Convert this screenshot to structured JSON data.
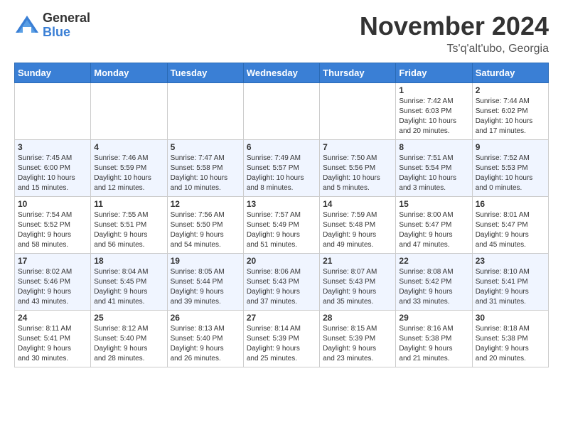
{
  "logo": {
    "general": "General",
    "blue": "Blue"
  },
  "header": {
    "month": "November 2024",
    "location": "Ts'q'alt'ubo, Georgia"
  },
  "weekdays": [
    "Sunday",
    "Monday",
    "Tuesday",
    "Wednesday",
    "Thursday",
    "Friday",
    "Saturday"
  ],
  "weeks": [
    [
      {
        "day": "",
        "info": ""
      },
      {
        "day": "",
        "info": ""
      },
      {
        "day": "",
        "info": ""
      },
      {
        "day": "",
        "info": ""
      },
      {
        "day": "",
        "info": ""
      },
      {
        "day": "1",
        "info": "Sunrise: 7:42 AM\nSunset: 6:03 PM\nDaylight: 10 hours\nand 20 minutes."
      },
      {
        "day": "2",
        "info": "Sunrise: 7:44 AM\nSunset: 6:02 PM\nDaylight: 10 hours\nand 17 minutes."
      }
    ],
    [
      {
        "day": "3",
        "info": "Sunrise: 7:45 AM\nSunset: 6:00 PM\nDaylight: 10 hours\nand 15 minutes."
      },
      {
        "day": "4",
        "info": "Sunrise: 7:46 AM\nSunset: 5:59 PM\nDaylight: 10 hours\nand 12 minutes."
      },
      {
        "day": "5",
        "info": "Sunrise: 7:47 AM\nSunset: 5:58 PM\nDaylight: 10 hours\nand 10 minutes."
      },
      {
        "day": "6",
        "info": "Sunrise: 7:49 AM\nSunset: 5:57 PM\nDaylight: 10 hours\nand 8 minutes."
      },
      {
        "day": "7",
        "info": "Sunrise: 7:50 AM\nSunset: 5:56 PM\nDaylight: 10 hours\nand 5 minutes."
      },
      {
        "day": "8",
        "info": "Sunrise: 7:51 AM\nSunset: 5:54 PM\nDaylight: 10 hours\nand 3 minutes."
      },
      {
        "day": "9",
        "info": "Sunrise: 7:52 AM\nSunset: 5:53 PM\nDaylight: 10 hours\nand 0 minutes."
      }
    ],
    [
      {
        "day": "10",
        "info": "Sunrise: 7:54 AM\nSunset: 5:52 PM\nDaylight: 9 hours\nand 58 minutes."
      },
      {
        "day": "11",
        "info": "Sunrise: 7:55 AM\nSunset: 5:51 PM\nDaylight: 9 hours\nand 56 minutes."
      },
      {
        "day": "12",
        "info": "Sunrise: 7:56 AM\nSunset: 5:50 PM\nDaylight: 9 hours\nand 54 minutes."
      },
      {
        "day": "13",
        "info": "Sunrise: 7:57 AM\nSunset: 5:49 PM\nDaylight: 9 hours\nand 51 minutes."
      },
      {
        "day": "14",
        "info": "Sunrise: 7:59 AM\nSunset: 5:48 PM\nDaylight: 9 hours\nand 49 minutes."
      },
      {
        "day": "15",
        "info": "Sunrise: 8:00 AM\nSunset: 5:47 PM\nDaylight: 9 hours\nand 47 minutes."
      },
      {
        "day": "16",
        "info": "Sunrise: 8:01 AM\nSunset: 5:47 PM\nDaylight: 9 hours\nand 45 minutes."
      }
    ],
    [
      {
        "day": "17",
        "info": "Sunrise: 8:02 AM\nSunset: 5:46 PM\nDaylight: 9 hours\nand 43 minutes."
      },
      {
        "day": "18",
        "info": "Sunrise: 8:04 AM\nSunset: 5:45 PM\nDaylight: 9 hours\nand 41 minutes."
      },
      {
        "day": "19",
        "info": "Sunrise: 8:05 AM\nSunset: 5:44 PM\nDaylight: 9 hours\nand 39 minutes."
      },
      {
        "day": "20",
        "info": "Sunrise: 8:06 AM\nSunset: 5:43 PM\nDaylight: 9 hours\nand 37 minutes."
      },
      {
        "day": "21",
        "info": "Sunrise: 8:07 AM\nSunset: 5:43 PM\nDaylight: 9 hours\nand 35 minutes."
      },
      {
        "day": "22",
        "info": "Sunrise: 8:08 AM\nSunset: 5:42 PM\nDaylight: 9 hours\nand 33 minutes."
      },
      {
        "day": "23",
        "info": "Sunrise: 8:10 AM\nSunset: 5:41 PM\nDaylight: 9 hours\nand 31 minutes."
      }
    ],
    [
      {
        "day": "24",
        "info": "Sunrise: 8:11 AM\nSunset: 5:41 PM\nDaylight: 9 hours\nand 30 minutes."
      },
      {
        "day": "25",
        "info": "Sunrise: 8:12 AM\nSunset: 5:40 PM\nDaylight: 9 hours\nand 28 minutes."
      },
      {
        "day": "26",
        "info": "Sunrise: 8:13 AM\nSunset: 5:40 PM\nDaylight: 9 hours\nand 26 minutes."
      },
      {
        "day": "27",
        "info": "Sunrise: 8:14 AM\nSunset: 5:39 PM\nDaylight: 9 hours\nand 25 minutes."
      },
      {
        "day": "28",
        "info": "Sunrise: 8:15 AM\nSunset: 5:39 PM\nDaylight: 9 hours\nand 23 minutes."
      },
      {
        "day": "29",
        "info": "Sunrise: 8:16 AM\nSunset: 5:38 PM\nDaylight: 9 hours\nand 21 minutes."
      },
      {
        "day": "30",
        "info": "Sunrise: 8:18 AM\nSunset: 5:38 PM\nDaylight: 9 hours\nand 20 minutes."
      }
    ]
  ]
}
